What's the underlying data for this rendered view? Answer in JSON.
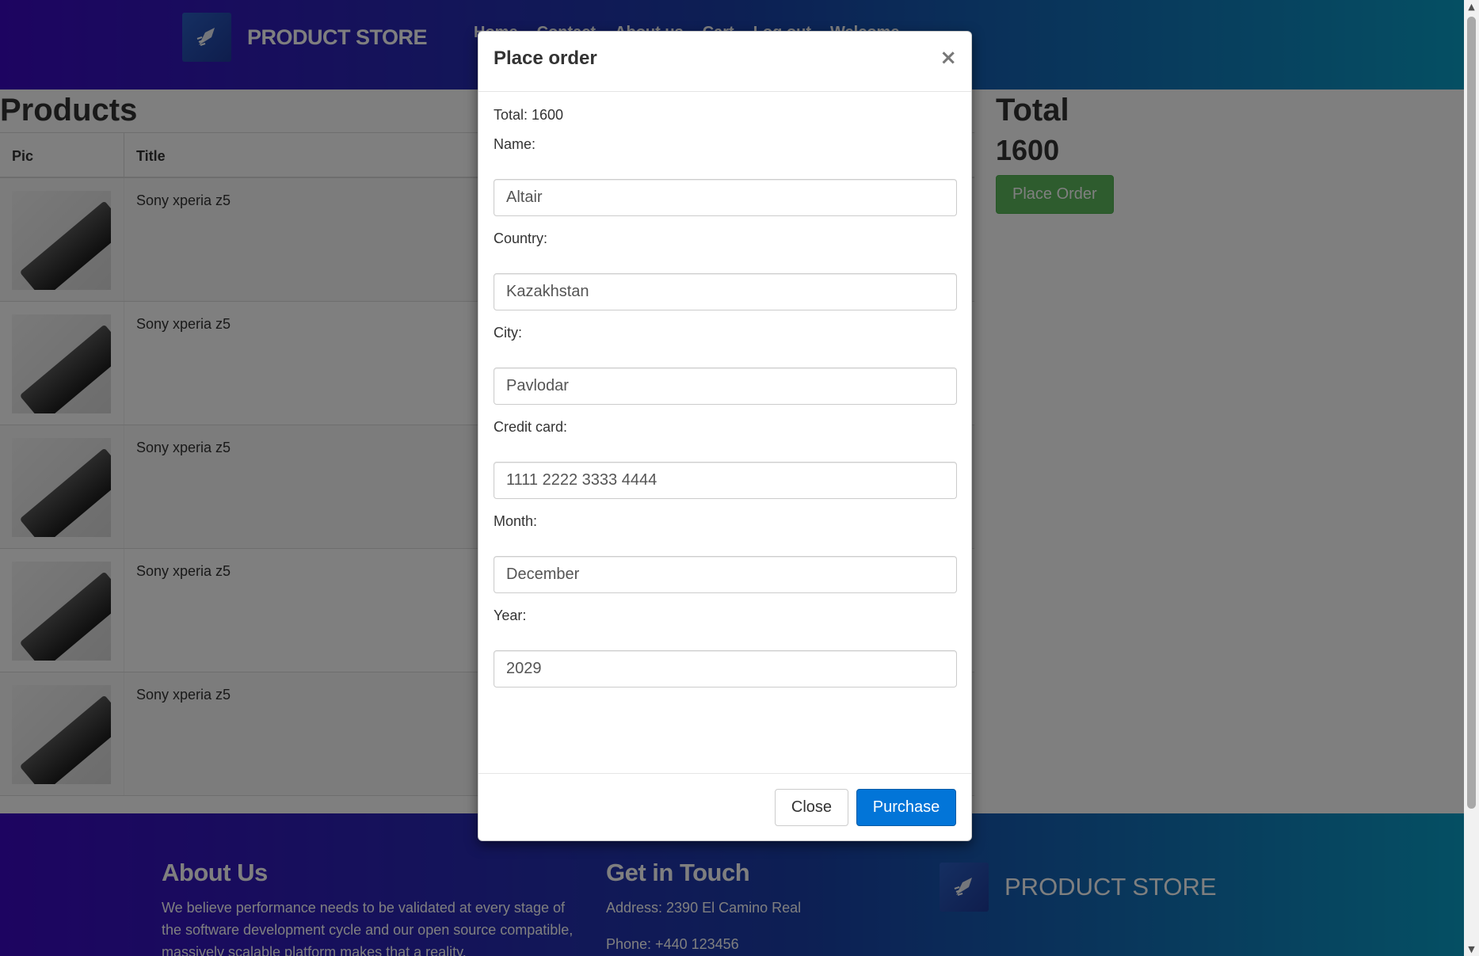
{
  "header": {
    "brand": "PRODUCT STORE",
    "nav": [
      "Home",
      "Contact",
      "About us",
      "Cart",
      "Log out",
      "Welcome"
    ]
  },
  "main": {
    "products_title": "Products",
    "columns": {
      "pic": "Pic",
      "title": "Title"
    },
    "rows": [
      {
        "title": "Sony xperia z5"
      },
      {
        "title": "Sony xperia z5"
      },
      {
        "title": "Sony xperia z5"
      },
      {
        "title": "Sony xperia z5"
      },
      {
        "title": "Sony xperia z5"
      }
    ],
    "total_label": "Total",
    "total_value": "1600",
    "place_order_label": "Place Order"
  },
  "footer": {
    "about_title": "About Us",
    "about_text": "We believe performance needs to be validated at every stage of the software development cycle and our open source compatible, massively scalable platform makes that a reality.",
    "contact_title": "Get in Touch",
    "address": "Address: 2390 El Camino Real",
    "phone": "Phone: +440 123456",
    "brand": "PRODUCT STORE"
  },
  "modal": {
    "title": "Place order",
    "close_x": "×",
    "total_line": "Total: 1600",
    "fields": [
      {
        "label": "Name:",
        "value": "Altair"
      },
      {
        "label": "Country:",
        "value": "Kazakhstan"
      },
      {
        "label": "City:",
        "value": "Pavlodar"
      },
      {
        "label": "Credit card:",
        "value": "1111 2222 3333 4444"
      },
      {
        "label": "Month:",
        "value": "December"
      },
      {
        "label": "Year:",
        "value": "2029"
      }
    ],
    "close_label": "Close",
    "purchase_label": "Purchase"
  },
  "colors": {
    "header_gradient_start": "#3b09c2",
    "header_gradient_end": "#0a9fc7",
    "place_order_button": "#5cb85c",
    "purchase_button": "#0275d8"
  },
  "icons": {
    "brand_logo": "rocket-hand-logo-icon",
    "modal_close": "close-icon"
  }
}
